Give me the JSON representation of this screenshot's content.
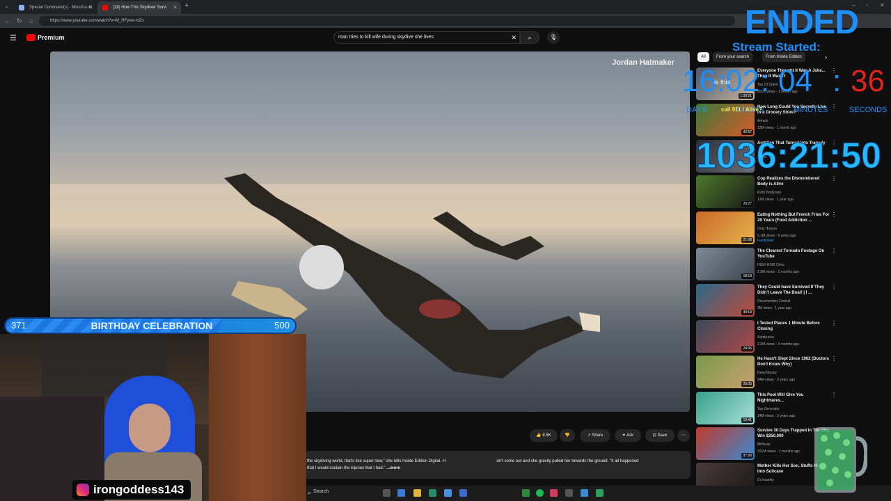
{
  "browser": {
    "tabs": [
      {
        "title": "Special Command(s) - MissXss AI",
        "favicon_color": "#8ab4f8"
      },
      {
        "title": "(28) How This Skydiver Survi",
        "favicon_color": "#ff0000"
      }
    ],
    "url": "https://www.youtube.com/watch?v=M_HFywx-mZo"
  },
  "youtube": {
    "logo_text": "Premium",
    "search_query": "man tries to kill wife during skydive she lives",
    "video": {
      "watermark": "Jordan Hatmaker"
    },
    "actions": {
      "like_count": "8.5K",
      "share": "Share",
      "ask": "Ask",
      "save": "Save"
    },
    "description": {
      "line1_left": "the skydiving world, that's like super new,\" she tells Inside Edition Digital. H",
      "line1_right": "dn't come out and she gravity pulled her towards the ground. \"It all happened",
      "line2": "that I would sustain the injuries that I had.\"",
      "more": "...more"
    },
    "filter_chips": [
      "All",
      "From your search",
      "From Inside Edition"
    ],
    "recommendations": [
      {
        "title": "Everyone Thought It Was A Joke... Then It Wasn't",
        "channel": "Top 10 Talent",
        "meta": "251K views · 1 month ago",
        "duration": "1:39:21",
        "thumb": [
          "#4a5a70",
          "#c9b39a"
        ]
      },
      {
        "title": "How Long Could You Secretly Live In a Grocery Store?",
        "channel": "Airrack",
        "meta": "13M views · 1 month ago",
        "duration": "42:57",
        "thumb": [
          "#3d7a3a",
          "#d45a2b"
        ]
      },
      {
        "title": "Audition That Turned Into Tragedy",
        "channel": "Trend",
        "meta": "",
        "duration": "",
        "thumb": [
          "#2a2f3a",
          "#6b6f7a"
        ]
      },
      {
        "title": "Cop Realizes the Dismembered Body is Alive",
        "channel": "EWU Bodycam",
        "meta": "13M views · 1 year ago",
        "duration": "20:27",
        "thumb": [
          "#4c7a2a",
          "#1a1a1a"
        ]
      },
      {
        "title": "Eating Nothing But French Fries For 26 Years (Food Addiction ...",
        "channel": "Only Human",
        "meta": "5.1M views · 5 years ago",
        "duration": "21:08",
        "thumb": [
          "#c96a2b",
          "#e6b24a"
        ],
        "badge": "Fundraiser"
      },
      {
        "title": "The Clearest Tornado Footage On YouTube",
        "channel": "HIGH RISK Chris",
        "meta": "2.2M views · 2 months ago",
        "duration": "18:18",
        "thumb": [
          "#7d8a96",
          "#3c4650"
        ]
      },
      {
        "title": "They Could have Survived If They Didn't Leave The Boat! | I ...",
        "channel": "Documentary Central",
        "meta": "3M views · 1 year ago",
        "duration": "49:19",
        "thumb": [
          "#2a6a8a",
          "#c04a3a"
        ]
      },
      {
        "title": "I Tested Places 1 Minute Before Closing",
        "channel": "Sambucha",
        "meta": "2.2M views · 2 months ago",
        "duration": "24:05",
        "thumb": [
          "#3a4a5a",
          "#b04a4a"
        ]
      },
      {
        "title": "He Hasn't Slept Since 1962 (Doctors Don't Know Why)",
        "channel": "Drew Binsky",
        "meta": "24M views · 3 years ago",
        "duration": "25:05",
        "thumb": [
          "#7a9a4a",
          "#c8a070"
        ]
      },
      {
        "title": "This Pool Will Give You Nightmares...",
        "channel": "Top Generatio",
        "meta": "14M views · 3 years ago",
        "duration": "19:41",
        "thumb": [
          "#3aa08a",
          "#a8e0d8"
        ]
      },
      {
        "title": "Survive 30 Days Trapped In The Sky, Win $250,000",
        "channel": "MrBeast",
        "meta": "151M views · 2 months ago",
        "duration": "37:26",
        "thumb": [
          "#c03a2a",
          "#3a8ad0"
        ]
      },
      {
        "title": "Mother Kills Her Son, Stuffs Him Into Suitcase",
        "channel": "Dr Insanity",
        "meta": "",
        "duration": "",
        "thumb": [
          "#4a3a3a",
          "#1a1a1a"
        ]
      }
    ]
  },
  "overlay": {
    "ended": "ENDED",
    "stream_started": "Stream Started:",
    "countdown": {
      "days": "16",
      "hours": "02",
      "minutes": "04",
      "seconds": "36",
      "colon": ":"
    },
    "countdown_labels": {
      "days": "DAYS",
      "hours": "HOURS",
      "minutes": "MINUTES",
      "seconds": "SECONDS"
    },
    "elapsed": "1036:21:50",
    "goal": {
      "current": 371,
      "target": 500,
      "label": "BIRTHDAY CELEBRATION"
    },
    "instagram_handle": "irongoddess143",
    "thumb_overlay_text": "is this",
    "thumb_overlay_text2": "call 911 / Alive?"
  },
  "taskbar": {
    "search_placeholder": "Search"
  },
  "colors": {
    "overlay_blue": "#1e8fff",
    "youtube_red": "#ff0000"
  }
}
